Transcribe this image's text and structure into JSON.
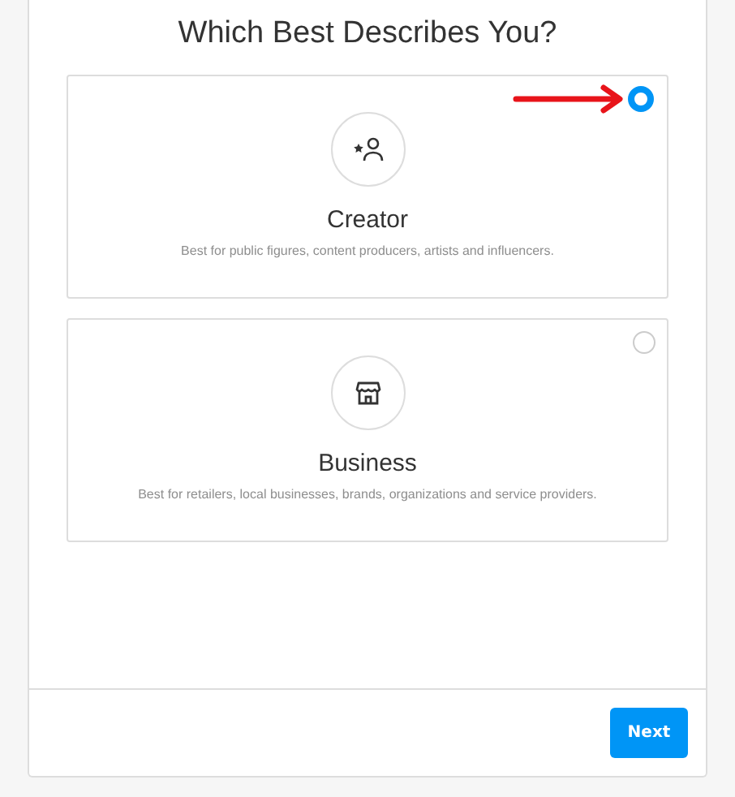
{
  "title": "Which Best Describes You?",
  "options": [
    {
      "kind": "creator",
      "label": "Creator",
      "description": "Best for public figures, content producers, artists and influencers.",
      "selected": true
    },
    {
      "kind": "business",
      "label": "Business",
      "description": "Best for retailers, local businesses, brands, organizations and service providers.",
      "selected": false
    }
  ],
  "annotation_arrow": true,
  "buttons": [
    {
      "label": "Next"
    }
  ]
}
